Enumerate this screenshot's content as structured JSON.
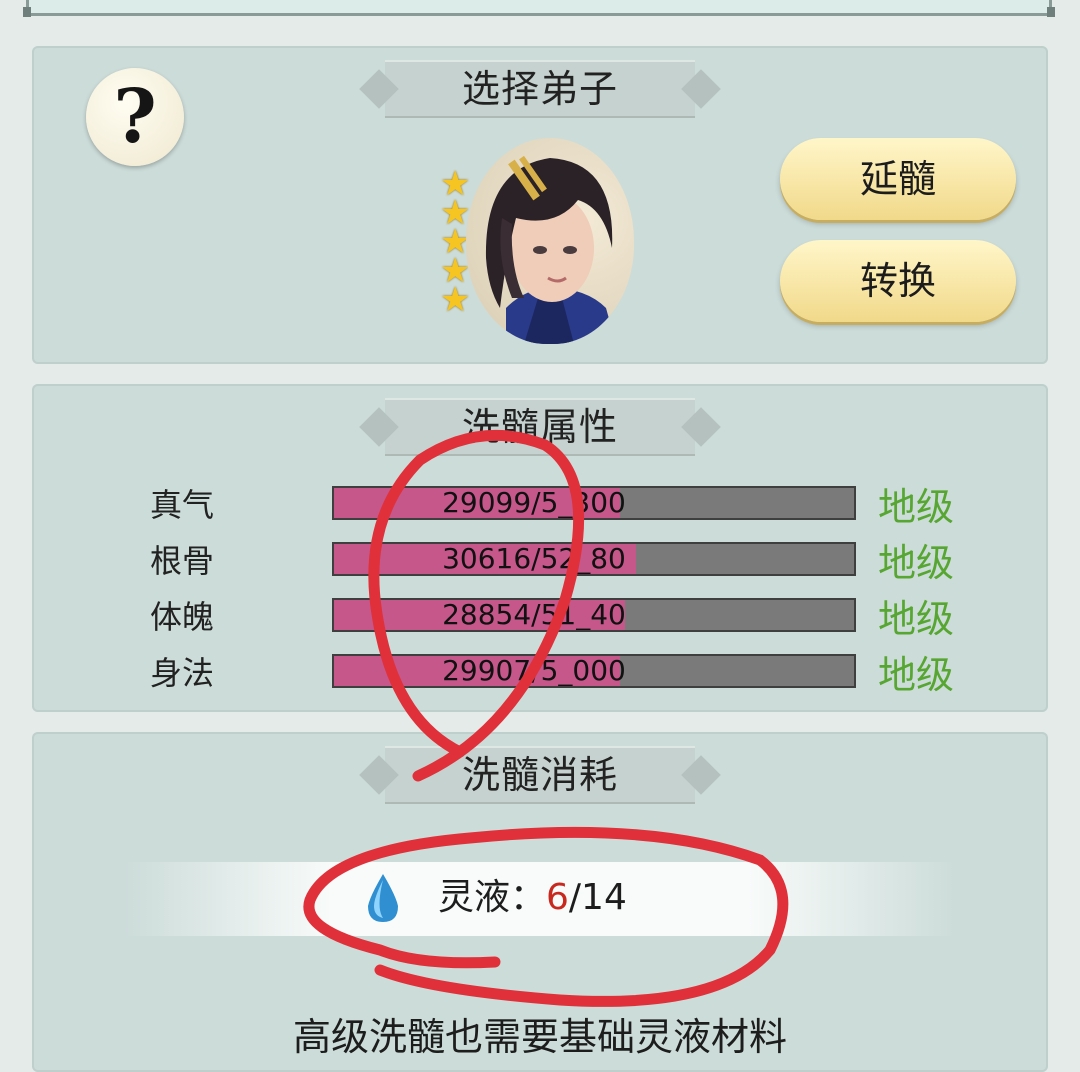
{
  "select_section": {
    "title": "选择弟子",
    "help_symbol": "?",
    "star_count": 5,
    "buttons": {
      "extend": "延髓",
      "convert": "转换"
    }
  },
  "attributes_section": {
    "title": "洗髓属性",
    "rows": [
      {
        "label": "真气",
        "bar_text": "29099/5_300",
        "grade": "地级",
        "fill_fraction": 0.55
      },
      {
        "label": "根骨",
        "bar_text": "30616/52_80",
        "grade": "地级",
        "fill_fraction": 0.58
      },
      {
        "label": "体魄",
        "bar_text": "28854/51_40",
        "grade": "地级",
        "fill_fraction": 0.56
      },
      {
        "label": "身法",
        "bar_text": "29907/5_000",
        "grade": "地级",
        "fill_fraction": 0.55
      }
    ]
  },
  "cost_section": {
    "title": "洗髓消耗",
    "label": "灵液：",
    "current": "6",
    "separator_total": "/14",
    "note": "高级洗髓也需要基础灵液材料"
  },
  "colors": {
    "panel": "#ccdcd9",
    "bar_fill": "#c6578a",
    "grade_green": "#56a631",
    "button_gold": "#f1d98a",
    "annotation_red": "#e0303a"
  }
}
